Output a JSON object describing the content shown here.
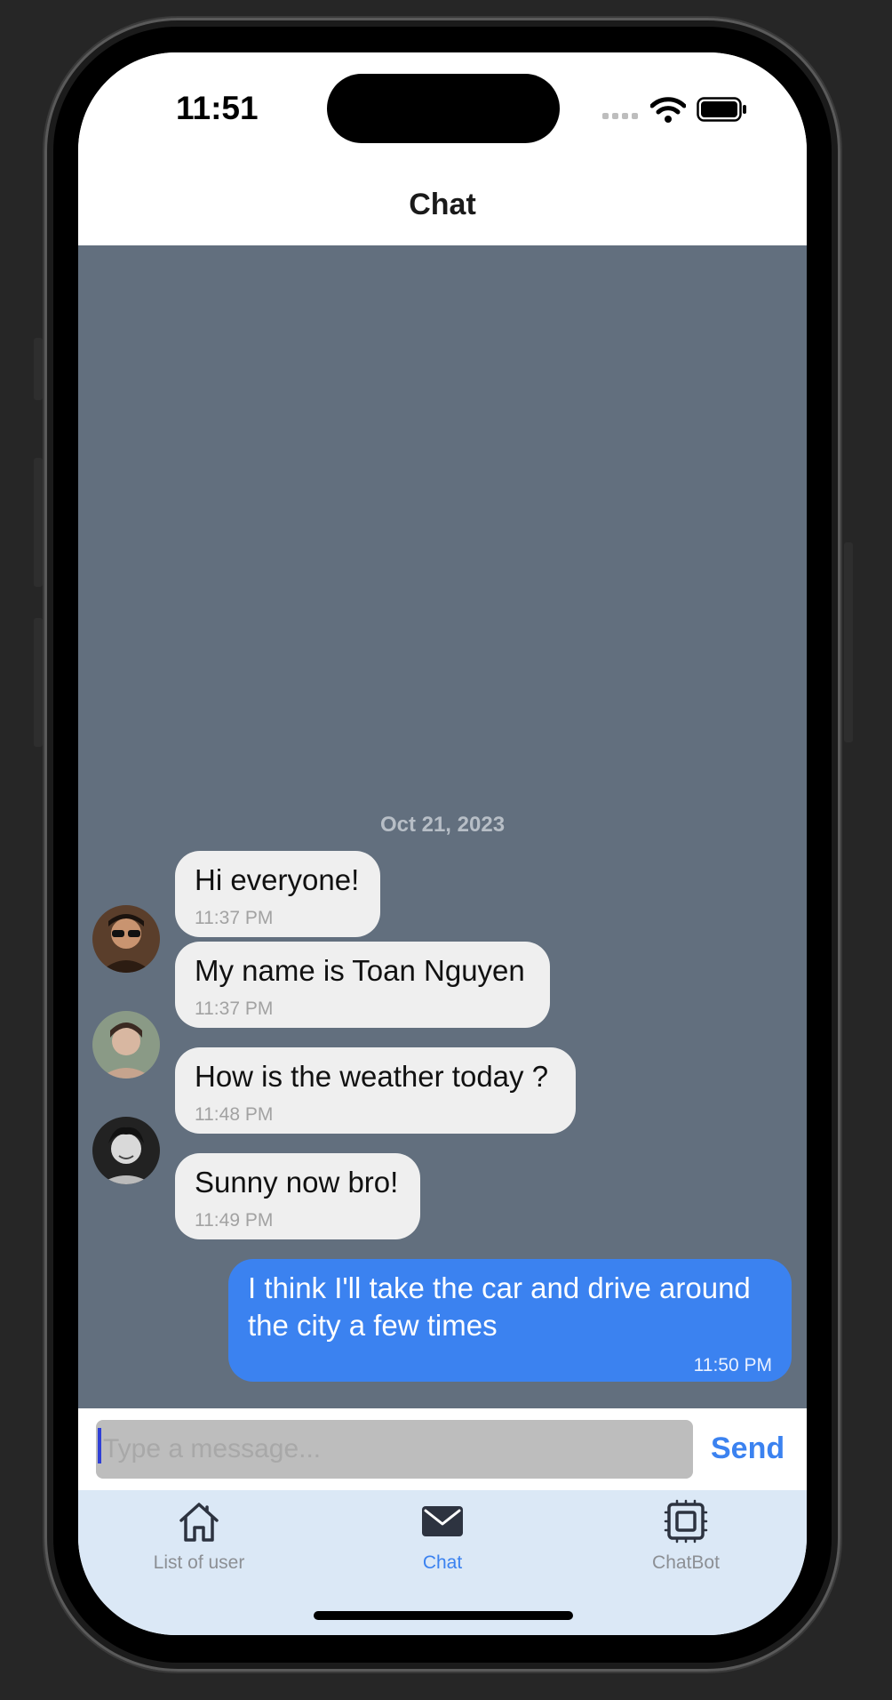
{
  "status_bar": {
    "time": "11:51"
  },
  "header": {
    "title": "Chat"
  },
  "chat": {
    "date_separator": "Oct 21, 2023",
    "messages": [
      {
        "text": "Hi everyone!",
        "time": "11:37 PM",
        "sender": "other",
        "avatar": false
      },
      {
        "text": "My name is Toan Nguyen",
        "time": "11:37 PM",
        "sender": "other",
        "avatar": true
      },
      {
        "text": "How is the weather today ?",
        "time": "11:48 PM",
        "sender": "other",
        "avatar": true
      },
      {
        "text": "Sunny now bro!",
        "time": "11:49 PM",
        "sender": "other",
        "avatar": true
      },
      {
        "text": "I think I'll take the car and drive around the city a few times",
        "time": "11:50 PM",
        "sender": "me",
        "avatar": false
      }
    ]
  },
  "composer": {
    "placeholder": "Type a message...",
    "value": "",
    "send_label": "Send"
  },
  "tabs": [
    {
      "label": "List of user",
      "icon": "home-icon",
      "active": false
    },
    {
      "label": "Chat",
      "icon": "mail-icon",
      "active": true
    },
    {
      "label": "ChatBot",
      "icon": "chip-icon",
      "active": false
    }
  ],
  "colors": {
    "accent": "#3b82f0",
    "chat_background": "#626f7e",
    "incoming_bubble": "#efefef",
    "tab_bar_background": "#dbe8f6"
  }
}
